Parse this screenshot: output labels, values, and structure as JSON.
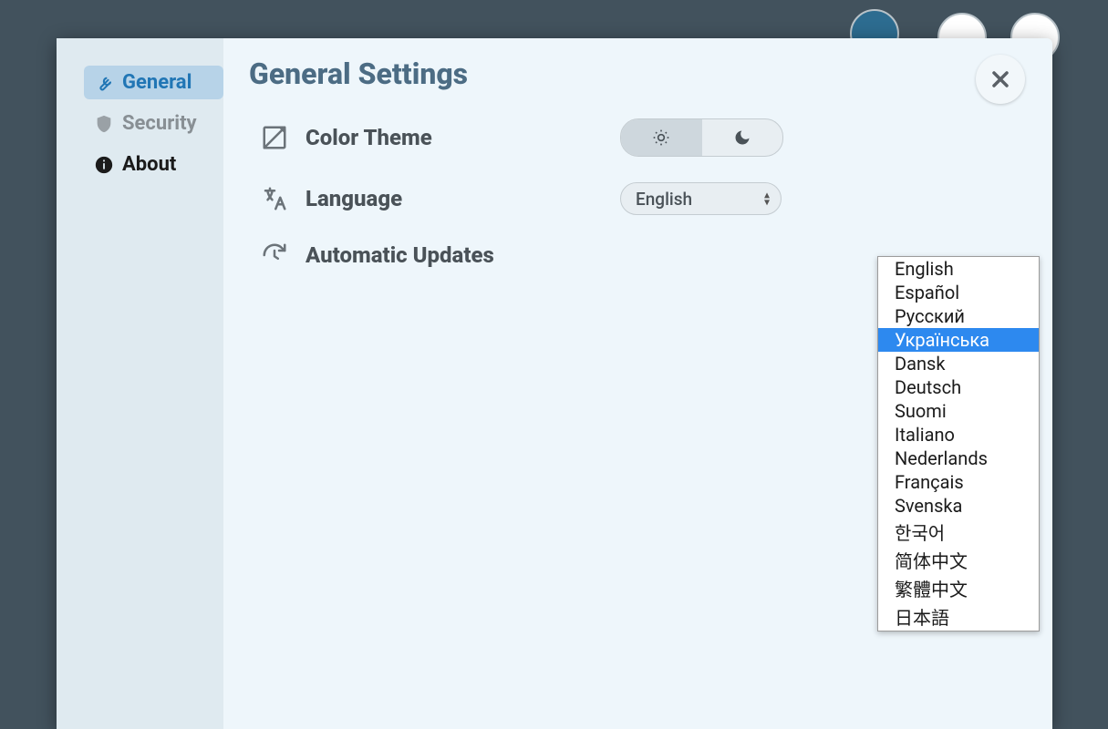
{
  "sidebar": {
    "general": "General",
    "security": "Security",
    "about": "About"
  },
  "header": {
    "title": "General Settings"
  },
  "settings": {
    "color_theme": "Color Theme",
    "language": "Language",
    "auto_updates": "Automatic Updates"
  },
  "language_select": {
    "value": "English",
    "options": [
      "English",
      "Español",
      "Русский",
      "Українська",
      "Dansk",
      "Deutsch",
      "Suomi",
      "Italiano",
      "Nederlands",
      "Français",
      "Svenska",
      "한국어",
      "简体中文",
      "繁體中文",
      "日本語"
    ],
    "highlighted_index": 3
  }
}
